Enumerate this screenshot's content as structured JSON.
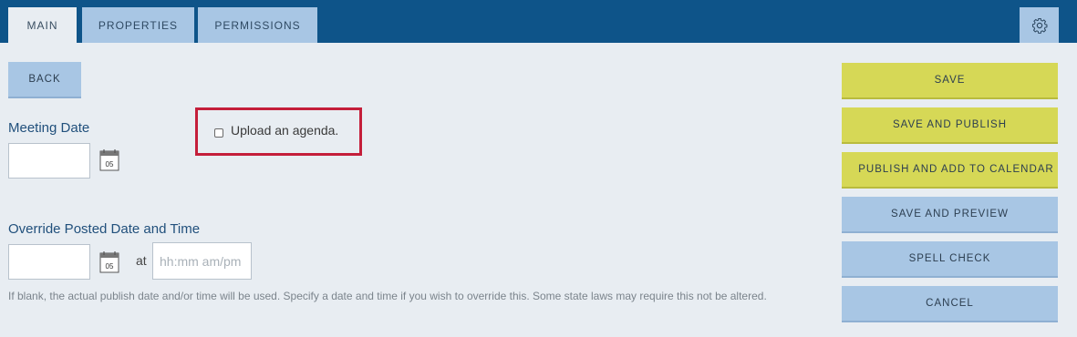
{
  "tabs": [
    {
      "label": "MAIN",
      "active": true
    },
    {
      "label": "PROPERTIES",
      "active": false
    },
    {
      "label": "PERMISSIONS",
      "active": false
    }
  ],
  "settings_icon": "gear-icon",
  "back_label": "BACK",
  "meeting_date": {
    "label": "Meeting Date",
    "value": "",
    "calendar_icon_text": "05"
  },
  "upload_agenda": {
    "label": "Upload an agenda.",
    "checked": false
  },
  "override": {
    "label": "Override Posted Date and Time",
    "date_value": "",
    "calendar_icon_text": "05",
    "at_label": "at",
    "time_placeholder": "hh:mm am/pm",
    "help_text": "If blank, the actual publish date and/or time will be used. Specify a date and time if you wish to override this. Some state laws may require this not be altered."
  },
  "actions": {
    "save": "SAVE",
    "save_publish": "SAVE AND PUBLISH",
    "publish_calendar": "PUBLISH AND ADD TO CALENDAR",
    "save_preview": "SAVE AND PREVIEW",
    "spell_check": "SPELL CHECK",
    "cancel": "CANCEL"
  },
  "colors": {
    "header": "#0e5489",
    "tab": "#a8c6e4",
    "primary_action": "#d6d856",
    "secondary_action": "#a8c6e4",
    "highlight_border": "#c41e3a"
  }
}
